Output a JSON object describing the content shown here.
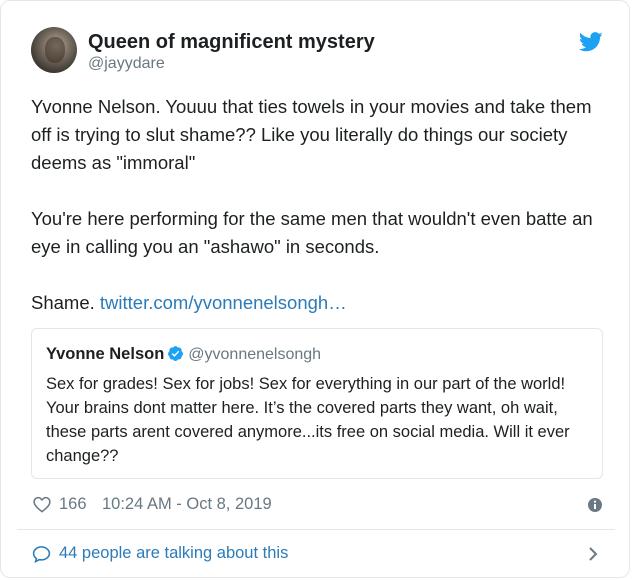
{
  "author": {
    "display_name": "Queen of magnificent mystery",
    "handle": "@jayydare"
  },
  "tweet": {
    "paragraph1": "Yvonne Nelson. Youuu that ties towels in your movies and take them off is trying to slut shame?? Like you literally do things our society deems as \"immoral\"",
    "paragraph2": "You're here performing for the same men that wouldn't even batte an eye in calling you an \"ashawo\" in seconds.",
    "paragraph3_text": "Shame.",
    "paragraph3_link": "twitter.com/yvonnenelsongh…"
  },
  "quoted_tweet": {
    "display_name": "Yvonne Nelson",
    "handle": "@yvonnenelsongh",
    "text": "Sex for grades! Sex for jobs! Sex for everything in our part of the world! Your brains dont matter here. It’s the covered  parts they want, oh wait, these parts arent covered anymore...its free on social media. Will it ever change??"
  },
  "meta": {
    "like_count": "166",
    "timestamp": "10:24 AM - Oct 8, 2019"
  },
  "footer": {
    "talking_label": "44 people are talking about this"
  },
  "icons": {
    "twitter": "twitter-bird-icon",
    "verified": "verified-badge-icon",
    "heart": "heart-icon",
    "info": "info-icon",
    "bubble": "speech-bubble-icon",
    "chevron": "chevron-right-icon"
  },
  "colors": {
    "twitter_blue": "#1da1f2",
    "link_blue": "#2b7bb9",
    "text": "#1c2022",
    "secondary_text": "#697882",
    "border": "#e1e8ed"
  }
}
